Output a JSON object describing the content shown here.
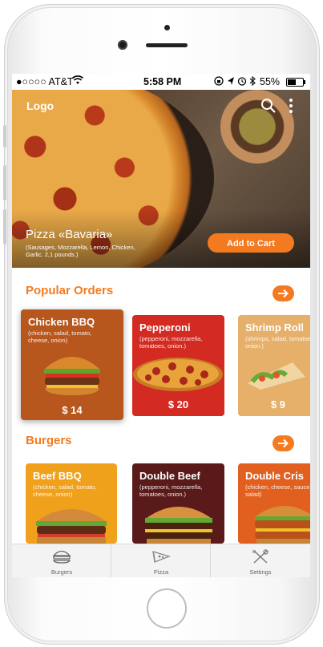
{
  "status_bar": {
    "carrier": "●○○○○ AT&T",
    "time": "5:58 PM",
    "battery": "55%"
  },
  "hero": {
    "logo": "Logo",
    "title": "Pizza «Bavaria»",
    "description": "(Sausages, Mozzarella, Lemon, Chicken, Garlic. 2,1 pounds.)",
    "add_to_cart": "Add to Cart"
  },
  "popular": {
    "title": "Popular Orders",
    "items": [
      {
        "name": "Chicken BBQ",
        "desc": "(chicken, salad, tomato, cheese, onion)",
        "price": "$ 14",
        "color": "#b7561d"
      },
      {
        "name": "Pepperoni",
        "desc": "(pepperoni, mozzarella, tomatoes, onion.)",
        "price": "$ 20",
        "color": "#d32a22"
      },
      {
        "name": "Shrimp Roll",
        "desc": "(shrimps, salad, tomatoes, onion.)",
        "price": "$ 9",
        "color": "#e6b06a"
      }
    ]
  },
  "burgers": {
    "title": "Burgers",
    "items": [
      {
        "name": "Beef BBQ",
        "desc": "(chicken, salad, tomato, cheese, onion)",
        "color": "#f0a11c"
      },
      {
        "name": "Double Beef",
        "desc": "(pepperoni, mozzarella, tomatoes, onion.)",
        "color": "#5a1a1a"
      },
      {
        "name": "Double Cris",
        "desc": "(chicken, cheese, sauce, salad)",
        "color": "#e2601f"
      }
    ]
  },
  "tabs": [
    {
      "label": "Burgers",
      "icon": "burger-icon"
    },
    {
      "label": "Pizza",
      "icon": "pizza-icon"
    },
    {
      "label": "Settings",
      "icon": "utensils-icon"
    }
  ],
  "colors": {
    "accent": "#f47a1f"
  }
}
